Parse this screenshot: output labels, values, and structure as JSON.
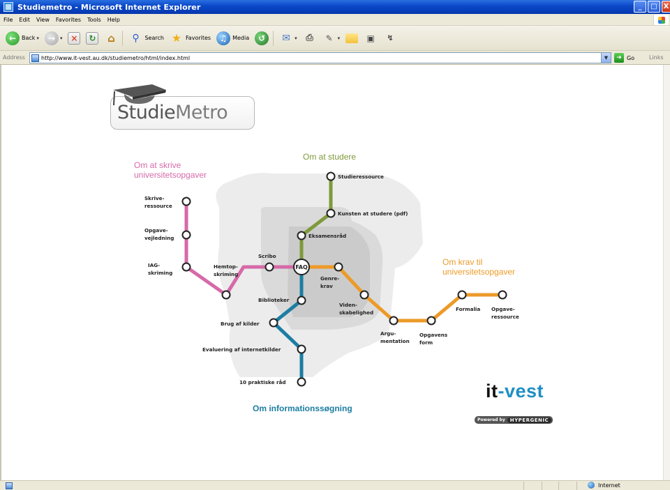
{
  "window": {
    "title": "Studiemetro - Microsoft Internet Explorer",
    "controls": [
      "_",
      "□",
      "X"
    ]
  },
  "menubar": {
    "items": [
      "File",
      "Edit",
      "View",
      "Favorites",
      "Tools",
      "Help"
    ]
  },
  "toolbar": {
    "back_label": "Back",
    "search_label": "Search",
    "favorites_label": "Favorites",
    "media_label": "Media"
  },
  "address": {
    "label": "Address",
    "url": "http://www.it-vest.au.dk/studiemetro/html/index.html",
    "go_label": "Go",
    "links_label": "Links"
  },
  "status": {
    "zone": "Internet"
  },
  "page": {
    "logo": {
      "part1": "Studie",
      "part2": "Metro"
    },
    "brand": {
      "it": "it",
      "vest": "-vest"
    },
    "powered": {
      "prefix": "Powered by",
      "name": "HYPERGENIC"
    }
  },
  "metro": {
    "colors": {
      "pink": "#d66aa8",
      "olive": "#7e9a3a",
      "orange": "#ec9a28",
      "blue": "#1c7da2",
      "zone_light": "#ececec",
      "zone_mid": "#dadada",
      "zone_dark": "#cbcbcb"
    },
    "lines": {
      "skrive": [
        "Om at skrive",
        "universitetsopgaver"
      ],
      "studere": [
        "Om at studere"
      ],
      "krav": [
        "Om krav til",
        "universitetsopgaver"
      ],
      "info": [
        "Om informationssøgning"
      ]
    },
    "hub": "FAQ",
    "stations": {
      "skrive_ressource": [
        "Skrive-",
        "ressource"
      ],
      "opgave_vejledning": [
        "Opgave-",
        "vejledning"
      ],
      "iag_skriming": [
        "IAG-",
        "skriming"
      ],
      "hemtop_skriming": [
        "Hemtop-",
        "skriming"
      ],
      "scribo": [
        "Scribo"
      ],
      "studieressource": [
        "Studieressource"
      ],
      "kunsten": [
        "Kunsten at studere (pdf)"
      ],
      "eksamensraad": [
        "Eksamensråd"
      ],
      "genre_krav": [
        "Genre-",
        "krav"
      ],
      "videnskabelighed": [
        "Viden-",
        "skabelighed"
      ],
      "argumentation": [
        "Argu-",
        "mentation"
      ],
      "opgavens_form": [
        "Opgavens",
        "form"
      ],
      "formalia": [
        "Formalia"
      ],
      "opgave_ressource": [
        "Opgave-",
        "ressource"
      ],
      "biblioteker": [
        "Biblioteker"
      ],
      "brug_af_kilder": [
        "Brug af kilder"
      ],
      "evaluering": [
        "Evaluering af internetkilder"
      ],
      "praktiske_raad": [
        "10 praktiske råd"
      ]
    }
  }
}
